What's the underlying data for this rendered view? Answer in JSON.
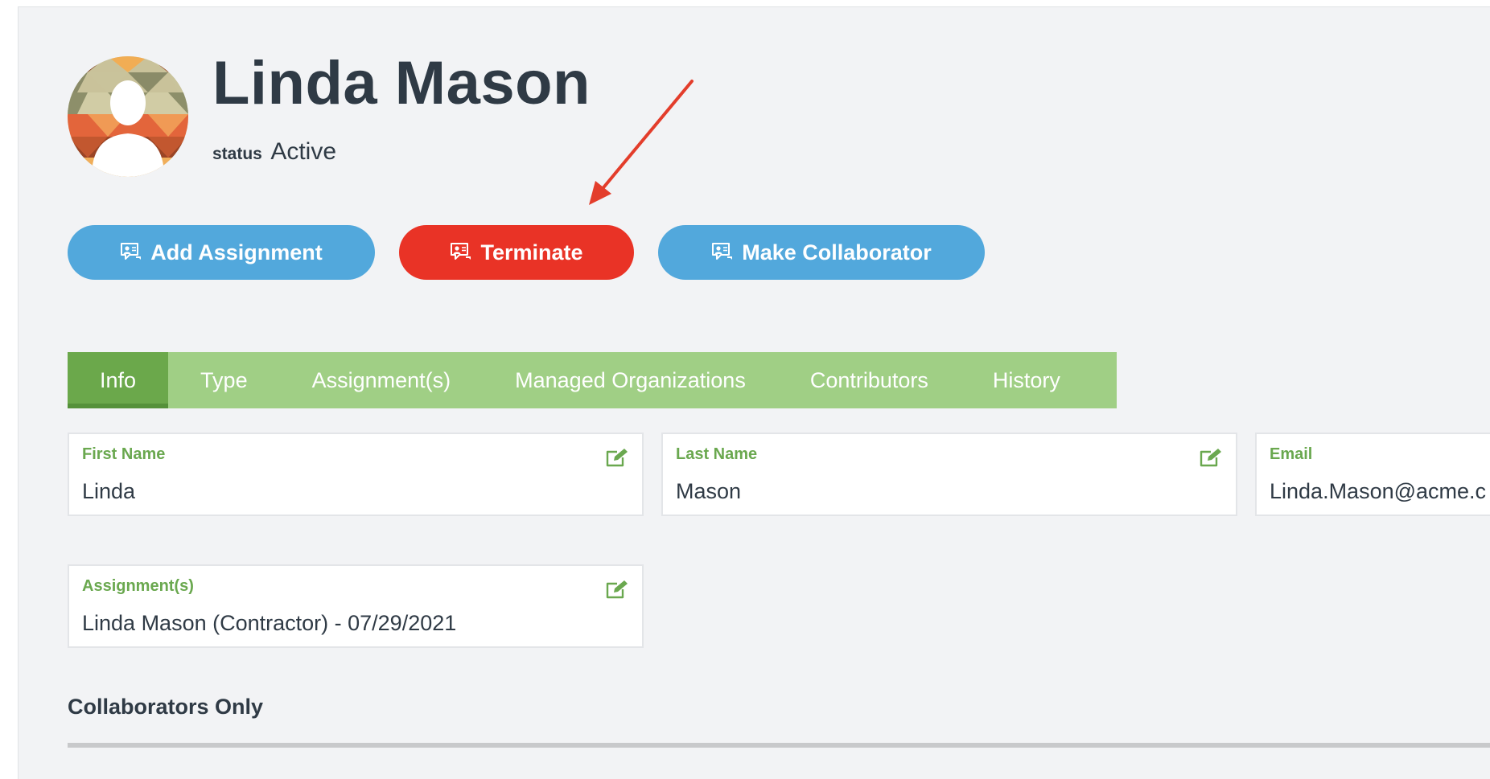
{
  "profile": {
    "name": "Linda Mason",
    "status_label": "status",
    "status_value": "Active",
    "avatar_icon": "user-avatar-icon"
  },
  "actions": {
    "add_assignment": "Add Assignment",
    "terminate": "Terminate",
    "make_collaborator": "Make Collaborator",
    "icon": "chat-user-icon"
  },
  "tabs": [
    {
      "label": "Info",
      "active": true
    },
    {
      "label": "Type",
      "active": false
    },
    {
      "label": "Assignment(s)",
      "active": false
    },
    {
      "label": "Managed Organizations",
      "active": false
    },
    {
      "label": "Contributors",
      "active": false
    },
    {
      "label": "History",
      "active": false
    }
  ],
  "fields": {
    "first_name": {
      "label": "First Name",
      "value": "Linda"
    },
    "last_name": {
      "label": "Last Name",
      "value": "Mason"
    },
    "email": {
      "label": "Email",
      "value": "Linda.Mason@acme.c"
    },
    "assignments": {
      "label": "Assignment(s)",
      "value": "Linda Mason (Contractor) - 07/29/2021"
    }
  },
  "sections": {
    "collaborators_only": "Collaborators Only"
  },
  "colors": {
    "accent_blue": "#52a8dc",
    "danger_red": "#e93326",
    "tab_green": "#a0cf85",
    "tab_active_green": "#6ba84b",
    "label_green": "#6aa84f",
    "annotation_arrow": "#e33d2b"
  }
}
